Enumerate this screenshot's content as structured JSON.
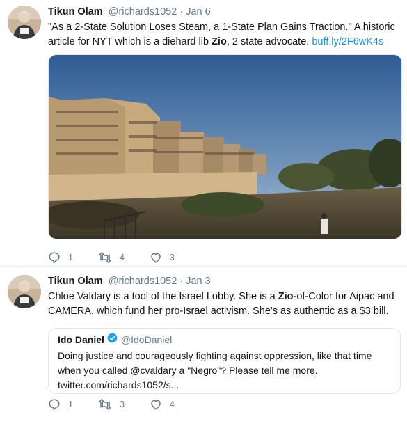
{
  "tweets": [
    {
      "author": "Tikun Olam",
      "handle": "@richards1052",
      "separator": "·",
      "date": "Jan 6",
      "text_before": "\"As a 2-State Solution Loses Steam, a 1-State Plan Gains Traction.\" A historic article for NYT which is a diehard lib ",
      "text_bold": "Zio",
      "text_after": ", 2 state advocate. ",
      "link": "buff.ly/2F6wK4s",
      "reply_count": "1",
      "retweet_count": "4",
      "like_count": "3"
    },
    {
      "author": "Tikun Olam",
      "handle": "@richards1052",
      "separator": "·",
      "date": "Jan 3",
      "text_before": "Chloe Valdary is a tool of the Israel Lobby.  She is a ",
      "text_bold": "Zio",
      "text_after": "-of-Color for Aipac and CAMERA, which fund her pro-Israel activism. She's as authentic as a $3 bill.",
      "quote": {
        "author": "Ido Daniel",
        "handle": "@IdoDaniel",
        "text": "Doing justice and courageously fighting against oppression, like that time when you called @cvaldary a \"Negro\"? Please tell me more.",
        "link": "twitter.com/richards1052/s..."
      },
      "reply_count": "1",
      "retweet_count": "3",
      "like_count": "4"
    }
  ],
  "icons": {
    "reply": "reply-icon",
    "retweet": "retweet-icon",
    "like": "heart-icon",
    "verified": "verified-badge-icon"
  },
  "colors": {
    "link": "#1b95e0",
    "secondary_text": "#657786",
    "verified": "#1da1f2",
    "divider": "#e6ecf0"
  }
}
